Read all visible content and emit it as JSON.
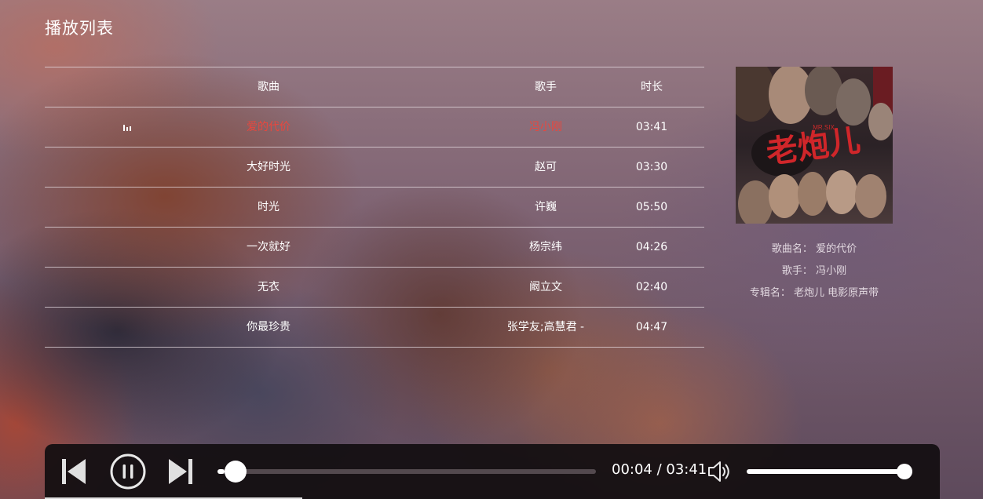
{
  "title": "播放列表",
  "table": {
    "columns": {
      "song": "歌曲",
      "artist": "歌手",
      "duration": "时长"
    },
    "rows": [
      {
        "song": "爱的代价",
        "artist": "冯小刚",
        "duration": "03:41",
        "playing": true
      },
      {
        "song": "大好时光",
        "artist": "赵可",
        "duration": "03:30"
      },
      {
        "song": "时光",
        "artist": "许巍",
        "duration": "05:50"
      },
      {
        "song": "一次就好",
        "artist": "杨宗纬",
        "duration": "04:26"
      },
      {
        "song": "无衣",
        "artist": "阚立文",
        "duration": "02:40"
      },
      {
        "song": "你最珍贵",
        "artist": "张学友;高慧君 -",
        "duration": "04:47"
      }
    ]
  },
  "now_playing": {
    "song_label": "歌曲名：",
    "song": "爱的代价",
    "artist_label": "歌手：",
    "artist": "冯小刚",
    "album_label": "专辑名：",
    "album": "老炮儿 电影原声带",
    "cover_text": "老炮儿",
    "cover_small": "MR.SIX"
  },
  "player": {
    "time": "00:04 / 03:41",
    "progress_fraction": 0.018,
    "volume_fraction": 1.0
  },
  "icons": {
    "prev": "skip-previous-icon",
    "pause": "pause-icon",
    "next": "skip-next-icon",
    "volume": "volume-icon",
    "playing": "equalizer-icon"
  },
  "colors": {
    "accent": "#e8473e",
    "text": "#ffffff"
  }
}
